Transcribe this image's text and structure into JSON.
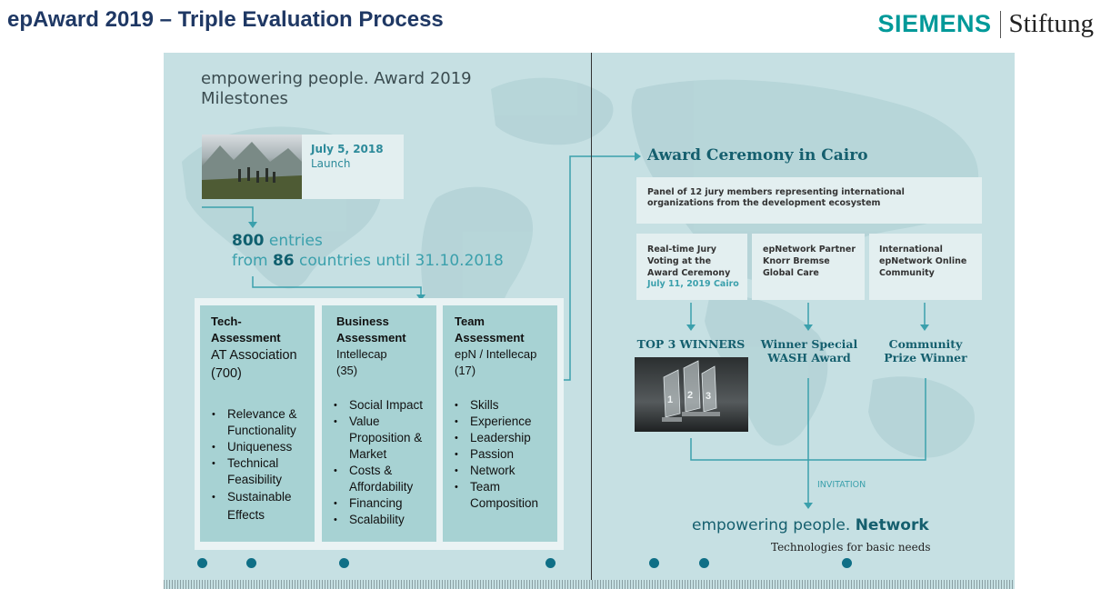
{
  "slide": {
    "title": "epAward 2019 – Triple Evaluation Process"
  },
  "brand": {
    "siemens": "SIEMENS",
    "stiftung": "Stiftung"
  },
  "poster": {
    "title_line1": "empowering people. Award 2019",
    "title_line2": "Milestones",
    "launch": {
      "date": "July 5, 2018",
      "label": "Launch"
    },
    "entries": {
      "count": "800",
      "count_suffix": " entries",
      "prefix": "from ",
      "countries": "86",
      "suffix": " countries until 31.10.2018"
    },
    "columns": [
      {
        "head_bold": "Tech-\nAssessment",
        "head_org": "AT Association\n(700)",
        "items": [
          "Relevance & Functionality",
          "Uniqueness",
          "Technical Feasibility",
          "Sustainable Effects"
        ]
      },
      {
        "head_bold": "Business\nAssessment",
        "head_org": "Intellecap\n(35)",
        "items": [
          "Social Impact",
          "Value Proposition & Market",
          "Costs & Affordability",
          "Financing",
          "Scalability"
        ]
      },
      {
        "head_bold": "Team\nAssessment",
        "head_org": "epN / Intellecap\n(17)",
        "items": [
          "Skills",
          "Experience",
          "Leadership",
          "Passion",
          "Network",
          "Team Composition"
        ]
      }
    ],
    "ceremony": {
      "title": "Award Ceremony in Cairo",
      "panel": "Panel of 12 jury members representing international organizations from the development ecosystem",
      "sub": [
        {
          "text": "Real-time Jury Voting at the Award Ceremony",
          "date": "July 11, 2019 Cairo"
        },
        {
          "text": "epNetwork Partner Knorr Bremse Global Care",
          "date": ""
        },
        {
          "text": "International epNetwork Online Community",
          "date": ""
        }
      ],
      "results": [
        "TOP 3 WINNERS",
        "Winner Special WASH Award",
        "Community Prize Winner"
      ],
      "invitation": "INVITATION",
      "network_plain": "empowering people.",
      "network_bold": "Network",
      "tagline": "Technologies for basic needs"
    }
  },
  "colors": {
    "accent": "#009999",
    "title": "#1f3864",
    "poster_bg": "#c6e0e3",
    "teal_dark": "#155f6e",
    "teal_light": "#3ba0ac",
    "column_bg": "#a7d2d3",
    "dot": "#0f6f86"
  },
  "icons": [
    "launch-photo",
    "trophy-photo",
    "timeline-dot",
    "flow-arrow"
  ]
}
